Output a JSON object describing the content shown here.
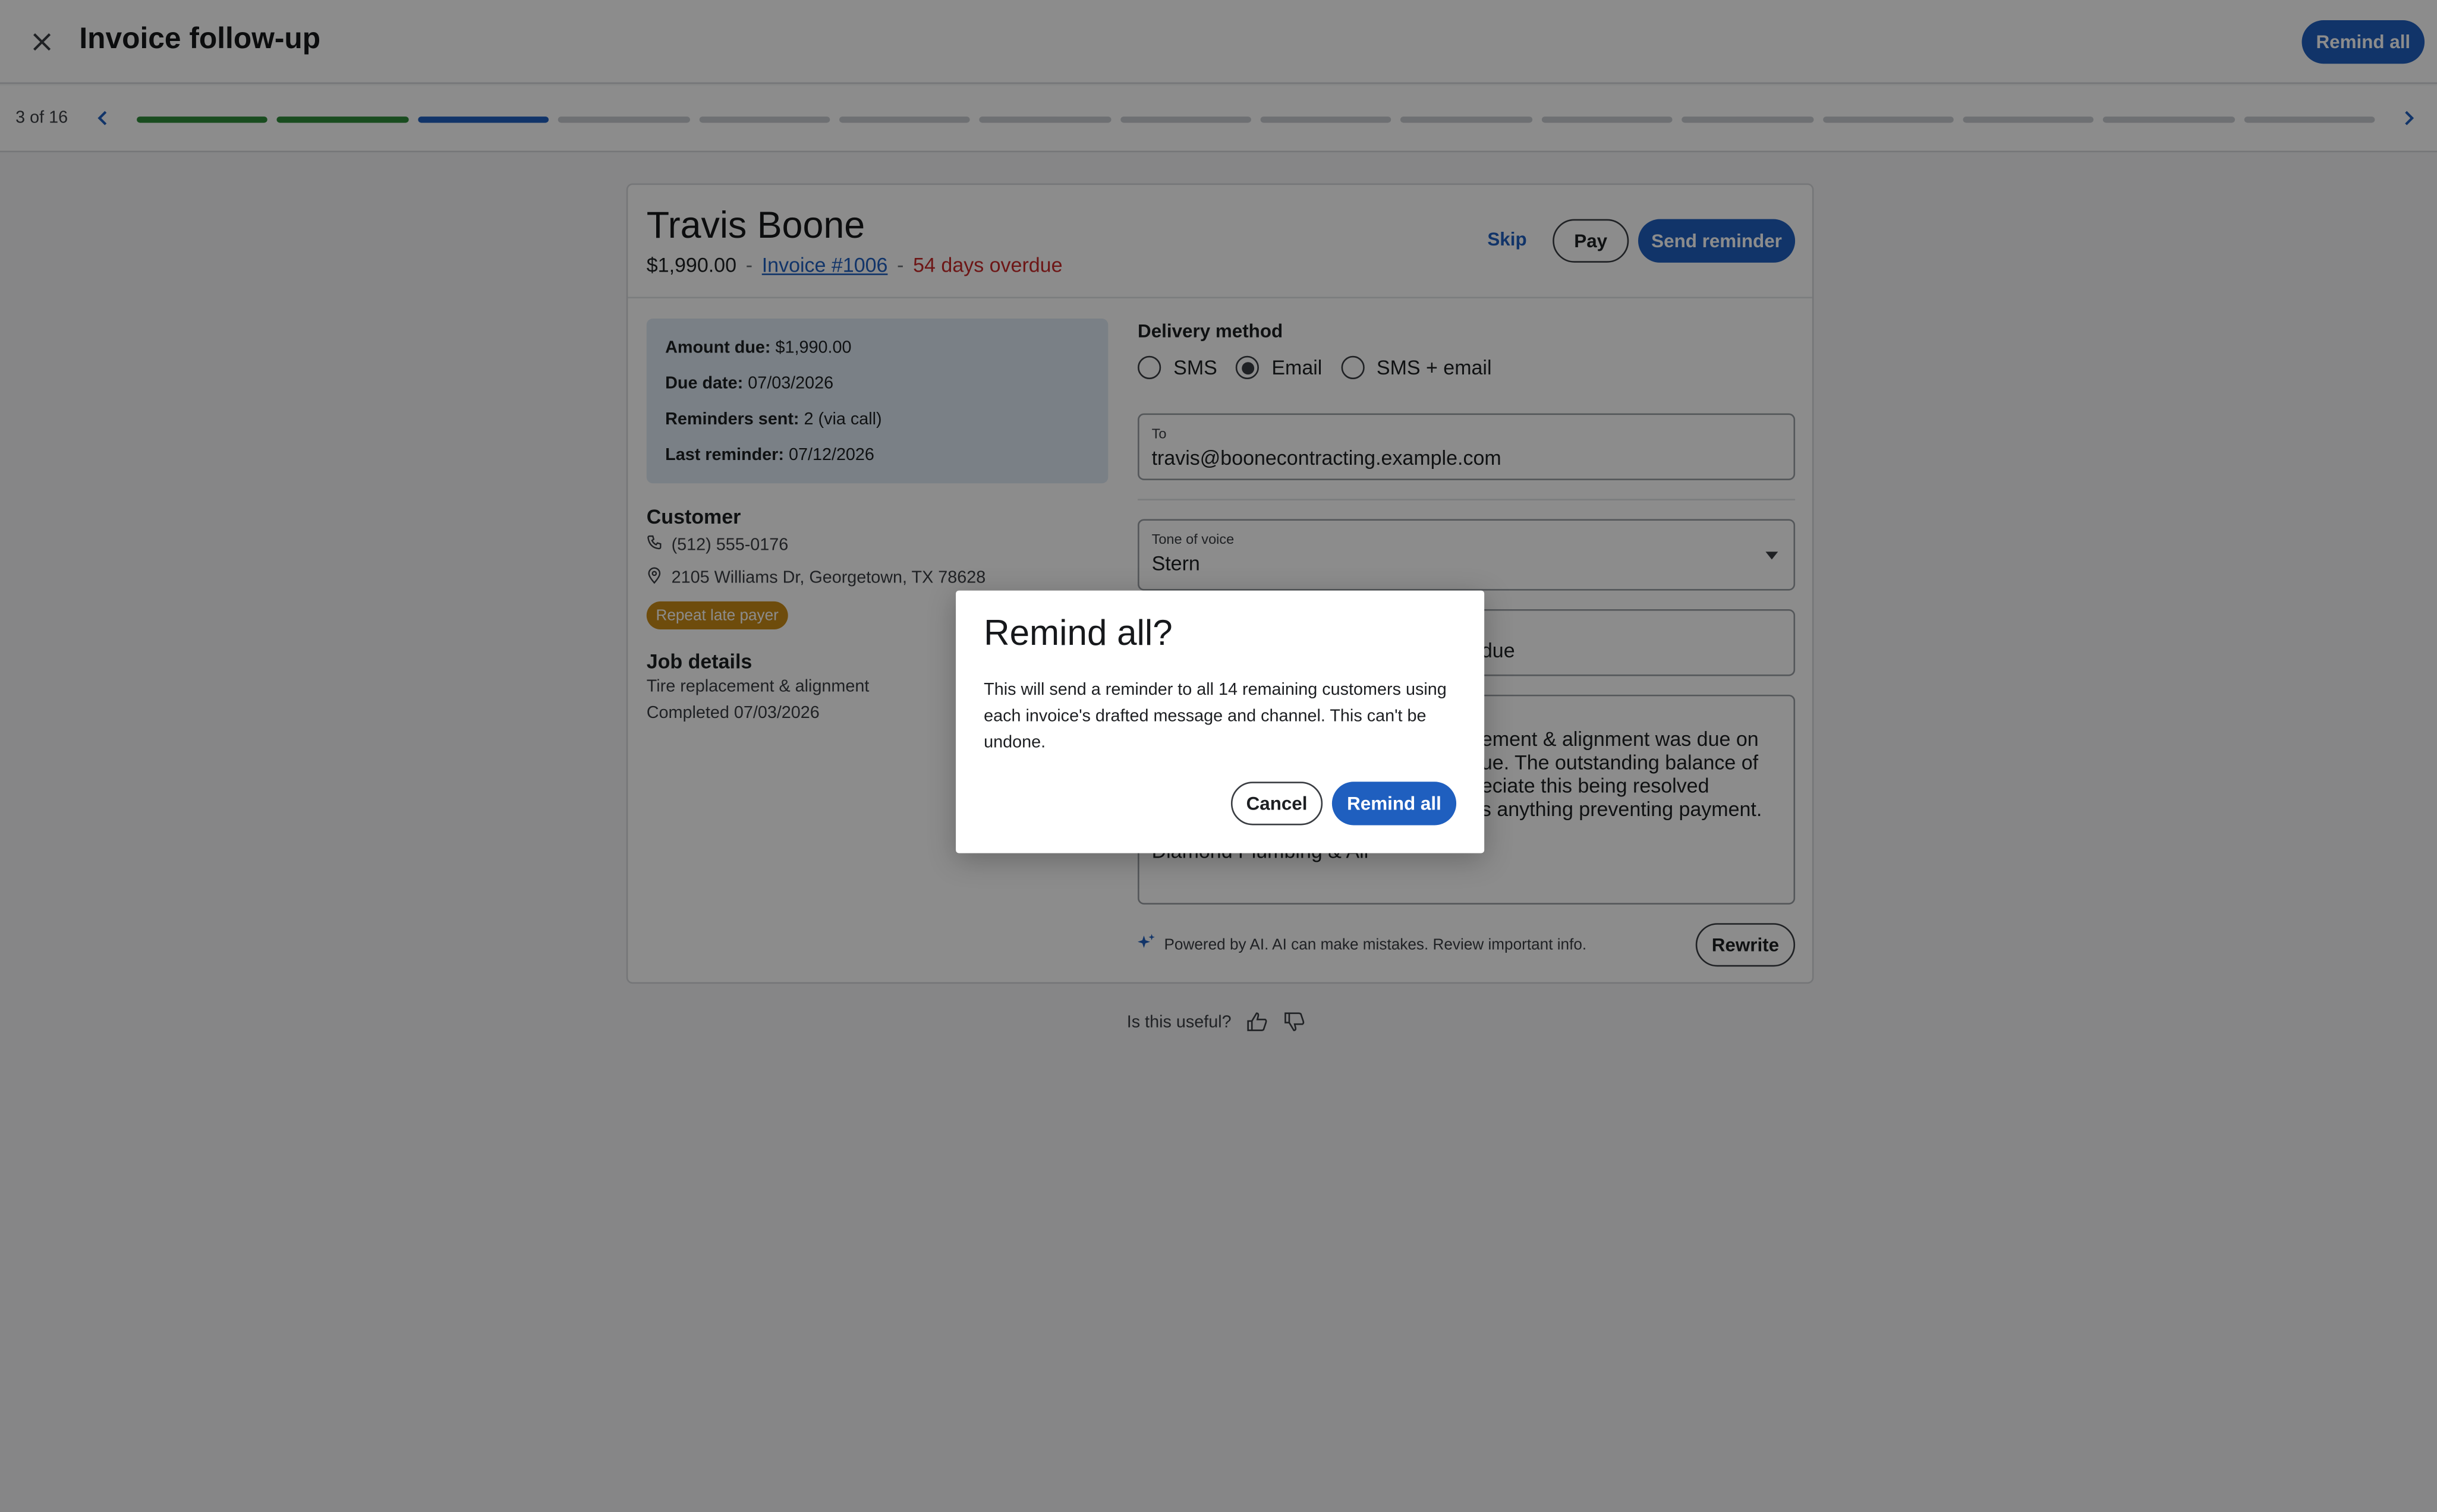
{
  "header": {
    "title": "Invoice follow-up",
    "remind_all_label": "Remind all"
  },
  "progress": {
    "label": "3 of 16",
    "current": 3,
    "total": 16,
    "completed": 2
  },
  "invoice": {
    "customer_name": "Travis Boone",
    "amount": "$1,990.00",
    "separator": "-",
    "invoice_link": "Invoice #1006",
    "overdue": "54 days overdue",
    "actions": {
      "skip": "Skip",
      "pay": "Pay",
      "send": "Send reminder"
    },
    "summary": [
      {
        "label": "Amount due:",
        "value": "$1,990.00"
      },
      {
        "label": "Due date:",
        "value": "07/03/2026"
      },
      {
        "label": "Reminders sent:",
        "value": "2 (via call)"
      },
      {
        "label": "Last reminder:",
        "value": "07/12/2026"
      }
    ],
    "customer": {
      "title": "Customer",
      "phone": "(512) 555-0176",
      "address": "2105 Williams Dr, Georgetown, TX 78628",
      "badge": "Repeat late payer"
    },
    "job": {
      "title": "Job details",
      "description": "Tire replacement & alignment",
      "completed": "Completed 07/03/2026"
    }
  },
  "delivery": {
    "title": "Delivery method",
    "options": [
      "SMS",
      "Email",
      "SMS + email"
    ],
    "selected": "Email",
    "to_label": "To",
    "to_value": "travis@boonecontracting.example.com",
    "tone_label": "Tone of voice",
    "tone_value": "Stern",
    "subject_visible": "due",
    "message_visible": [
      "ement & alignment was due on",
      "ue. The outstanding balance of",
      "eciate this being resolved",
      "s anything preventing payment.",
      "Diamond Plumbing & Air"
    ],
    "ai_disclaimer": "Powered by AI. AI can make mistakes. Review important info.",
    "rewrite_label": "Rewrite"
  },
  "feedback": {
    "question": "Is this useful?"
  },
  "dialog": {
    "title": "Remind all?",
    "body": "This will send a reminder to all 14 remaining customers using each invoice's drafted message and channel. This can't be undone.",
    "cancel": "Cancel",
    "confirm": "Remind all"
  },
  "colors": {
    "accent": "#1f5fbf",
    "done": "#2e8b3a",
    "overdue": "#c62828",
    "badge": "#c98a16"
  }
}
